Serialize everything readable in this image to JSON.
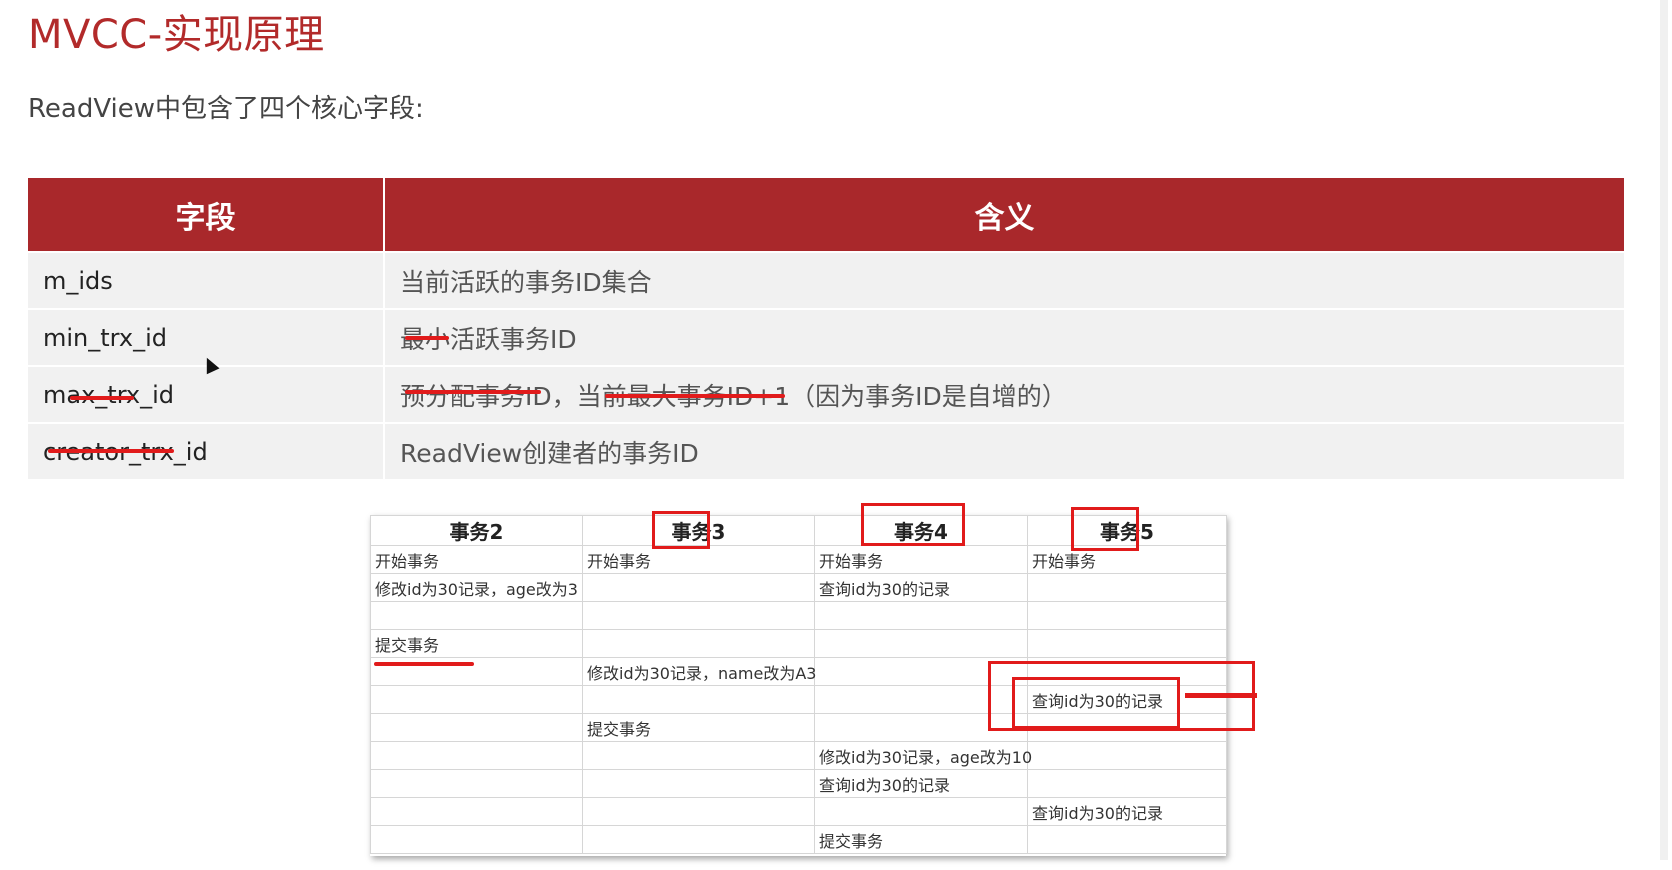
{
  "title": "MVCC-实现原理",
  "subtitle": "ReadView中包含了四个核心字段:",
  "fields_table": {
    "headers": [
      "字段",
      "含义"
    ],
    "rows": [
      {
        "field": "m_ids",
        "meaning": "当前活跃的事务ID集合"
      },
      {
        "field": "min_trx_id",
        "meaning": "最小活跃事务ID"
      },
      {
        "field": "max_trx_id",
        "meaning": "预分配事务ID，当前最大事务ID+1（因为事务ID是自增的）"
      },
      {
        "field": "creator_trx_id",
        "meaning": "ReadView创建者的事务ID"
      }
    ]
  },
  "tx_table": {
    "headers": [
      "事务2",
      "事务3",
      "事务4",
      "事务5"
    ],
    "rows": [
      [
        "开始事务",
        "开始事务",
        "开始事务",
        "开始事务"
      ],
      [
        "修改id为30记录，age改为3",
        "",
        "查询id为30的记录",
        ""
      ],
      [
        "",
        "",
        "",
        ""
      ],
      [
        "提交事务",
        "",
        "",
        ""
      ],
      [
        "",
        "修改id为30记录，name改为A3",
        "",
        ""
      ],
      [
        "",
        "",
        "",
        "查询id为30的记录"
      ],
      [
        "",
        "提交事务",
        "",
        ""
      ],
      [
        "",
        "",
        "修改id为30记录，age改为10",
        ""
      ],
      [
        "",
        "",
        "查询id为30的记录",
        ""
      ],
      [
        "",
        "",
        "",
        "查询id为30的记录"
      ],
      [
        "",
        "",
        "提交事务",
        ""
      ]
    ]
  },
  "colors": {
    "accent": "#a9282b",
    "title": "#b22a2a",
    "highlight": "#e11b1b"
  }
}
